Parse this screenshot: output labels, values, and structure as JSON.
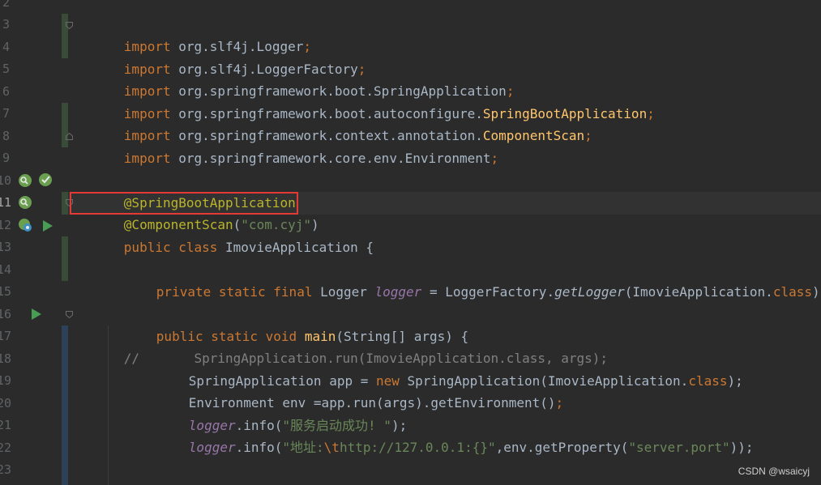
{
  "line_numbers": [
    "2",
    "3",
    "4",
    "5",
    "6",
    "7",
    "8",
    "9",
    "10",
    "11",
    "12",
    "13",
    "14",
    "15",
    "16",
    "17",
    "18",
    "19",
    "20",
    "21",
    "22",
    "23"
  ],
  "code": {
    "l3": [
      "import",
      " org.slf4j.Logger",
      ";"
    ],
    "l4": [
      "import",
      " org.slf4j.LoggerFactory",
      ";"
    ],
    "l5": [
      "import",
      " org.springframework.boot.SpringApplication",
      ";"
    ],
    "l6": [
      "import",
      " org.springframework.boot.autoconfigure.",
      "SpringBootApplication",
      ";"
    ],
    "l7": [
      "import",
      " org.springframework.context.annotation.",
      "ComponentScan",
      ";"
    ],
    "l8": [
      "import",
      " org.springframework.core.env.Environment",
      ";"
    ],
    "l10": [
      "@SpringBootApplication"
    ],
    "l11": [
      "@ComponentScan",
      "(",
      "\"com.cyj\"",
      ")"
    ],
    "l12": [
      "public class",
      " ImovieApplication {"
    ],
    "l14": [
      "private static final",
      " Logger ",
      "logger",
      " = LoggerFactory.",
      "getLogger",
      "(ImovieApplication.",
      "class",
      ");"
    ],
    "l16": [
      "public static void",
      " ",
      "main",
      "(String[] args) {"
    ],
    "l17": [
      "//       SpringApplication.run(ImovieApplication.class, args);"
    ],
    "l18": [
      "SpringApplication app = ",
      "new",
      " SpringApplication(ImovieApplication.",
      "class",
      ");"
    ],
    "l19": [
      "Environment env =app.run(args).getEnvironment()",
      ";"
    ],
    "l20": [
      "logger",
      ".info(",
      "\"服务启动成功! \"",
      ");"
    ],
    "l21": [
      "logger",
      ".info(",
      "\"地址:",
      "\\t",
      "http://127.0.0.1:{}\"",
      ",env.getProperty(",
      "\"server.port\"",
      "));"
    ]
  },
  "watermark": "CSDN @wsaicyj",
  "colors": {
    "background": "#2b2b2b",
    "keyword": "#cc7832",
    "annotation": "#bbb529",
    "string": "#6a8759",
    "method": "#ffc66d",
    "field": "#9876aa",
    "highlight_box": "#e53935"
  },
  "gutter_icons": [
    "spring-bean-icon",
    "run-config-icon",
    "spring-bean-icon",
    "spring-app-icon",
    "run-icon",
    "run-icon"
  ]
}
